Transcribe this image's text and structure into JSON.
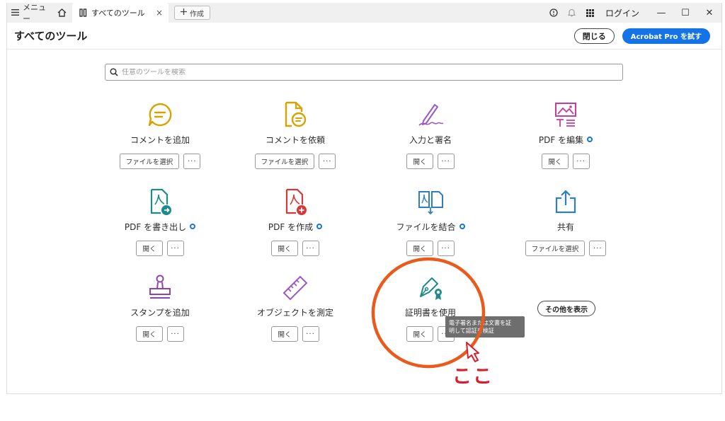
{
  "titlebar": {
    "menu_label": "メニュー",
    "tab_label": "すべてのツール",
    "tab_close": "×",
    "new_tab_label": "作成",
    "login_label": "ログイン",
    "minimize": "—",
    "maximize": "☐",
    "close": "✕"
  },
  "header": {
    "title": "すべてのツール",
    "close_label": "閉じる",
    "trial_label": "Acrobat Pro を試す"
  },
  "search": {
    "placeholder": "任意のツールを検索"
  },
  "tools": [
    {
      "name": "コメントを追加",
      "action": "ファイルを選択",
      "more": "···"
    },
    {
      "name": "コメントを依頼",
      "action": "ファイルを選択",
      "more": "···"
    },
    {
      "name": "入力と署名",
      "action": "開く",
      "more": "···"
    },
    {
      "name": "PDF を編集",
      "action": "開く",
      "more": "···"
    },
    {
      "name": "PDF を書き出し",
      "action": "開く",
      "more": "···"
    },
    {
      "name": "PDF を作成",
      "action": "開く",
      "more": "···"
    },
    {
      "name": "ファイルを結合",
      "action": "開く",
      "more": "···"
    },
    {
      "name": "共有",
      "action": "ファイルを選択",
      "more": "···"
    },
    {
      "name": "スタンプを追加",
      "action": "開く",
      "more": "···"
    },
    {
      "name": "オブジェクトを測定",
      "action": "開く",
      "more": "···"
    },
    {
      "name": "証明書を使用",
      "action": "開く",
      "more": "···"
    }
  ],
  "show_more_label": "その他を表示",
  "tooltip": {
    "line1": "電子署名または文書を証",
    "line2": "明して認証を検証"
  },
  "annotation": {
    "text": "ここ",
    "color": "#e85b1c",
    "text_color": "#d81e2c"
  },
  "colors": {
    "accent": "#1473e6",
    "comment": "#d8a300",
    "sign": "#9b59c6",
    "edit": "#c83c9c",
    "export": "#1e8a8a",
    "create": "#d93838",
    "share": "#2c7fc4",
    "stamp": "#8e44ad"
  }
}
